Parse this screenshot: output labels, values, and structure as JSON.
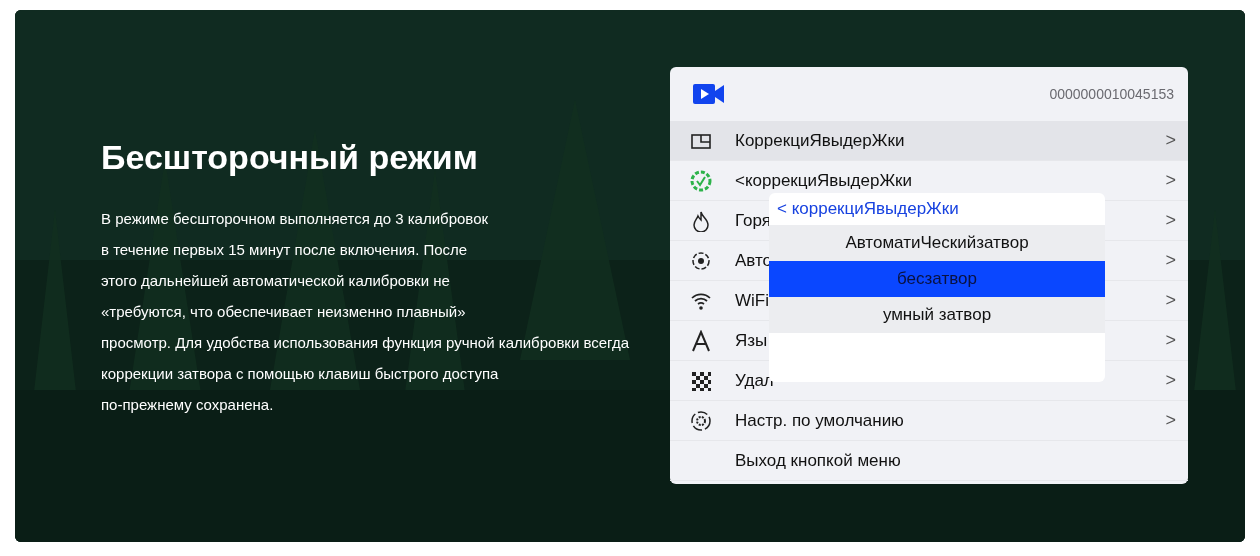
{
  "hero": {
    "title": "Бесшторочный режим",
    "lines": [
      "В режиме бесшторочном  выполняется до 3 калибровок",
      "в течение первых 15 минут после включения. После",
      "этого дальнейшей автоматической калибровки не",
      "«требуются, что обеспечивает неизменно плавный»",
      "просмотр. Для удобства использования функция ручной калибровки всегда",
      "коррекции затвора с помощью клавиш быстрого доступа",
      "по-прежнему сохранена."
    ]
  },
  "device_menu": {
    "serial": "0000000010045153",
    "items": [
      {
        "label": "КоррекциЯвыдерЖки",
        "selected": true,
        "arrow": true
      },
      {
        "label": "<коррекциЯвыдерЖки",
        "selected": false,
        "arrow": true
      },
      {
        "label": "Горя",
        "selected": false,
        "arrow": true
      },
      {
        "label": "Авто",
        "selected": false,
        "arrow": true
      },
      {
        "label": "WiFi",
        "selected": false,
        "arrow": true
      },
      {
        "label": "Язы",
        "selected": false,
        "arrow": true
      },
      {
        "label": "Удал",
        "selected": false,
        "arrow": true
      },
      {
        "label": "Настр. по умолчанию",
        "selected": false,
        "arrow": true
      },
      {
        "label": "Выход кнопкой меню",
        "selected": false,
        "arrow": false
      }
    ],
    "arrow_glyph": ">",
    "popup": {
      "title": "< коррекциЯвыдерЖки",
      "options": [
        {
          "label": "АвтоматиЧескийзатвор",
          "selected": false
        },
        {
          "label": "бесзатвор",
          "selected": true
        },
        {
          "label": "умный затвор",
          "selected": false
        }
      ]
    }
  }
}
